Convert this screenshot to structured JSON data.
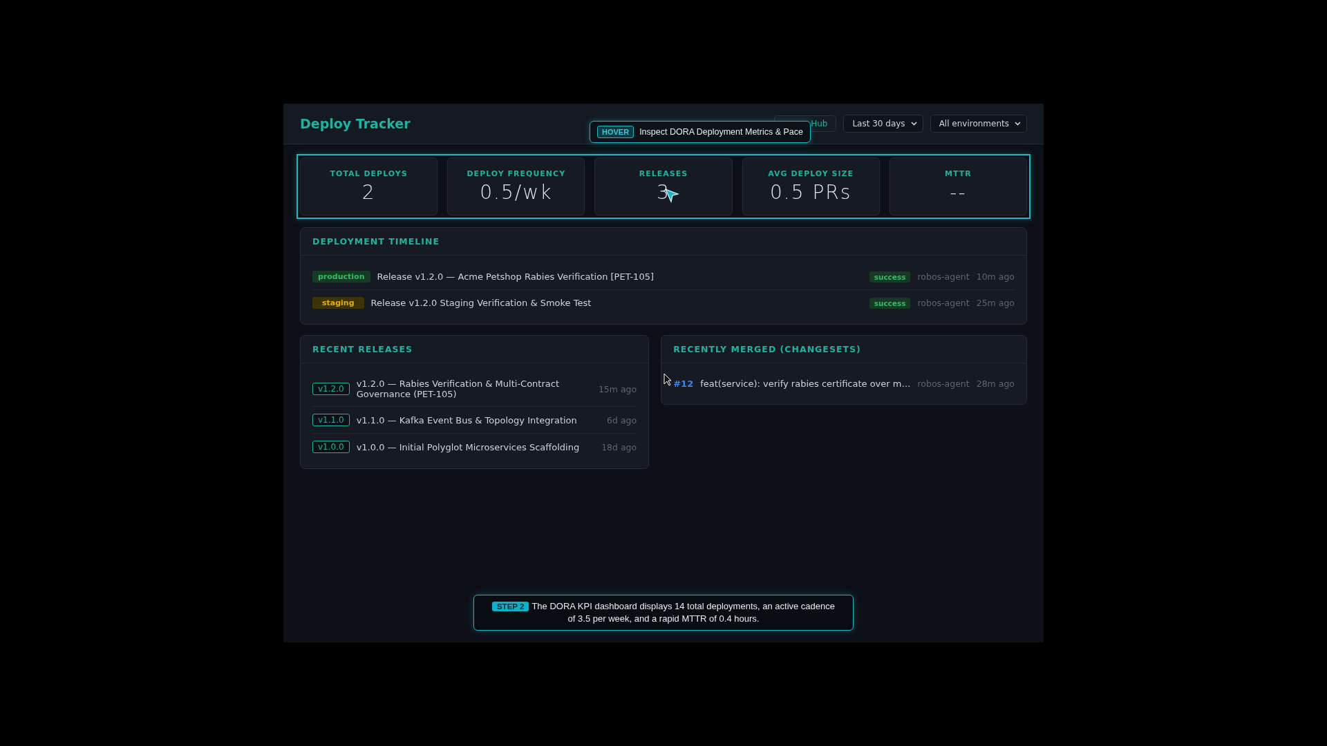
{
  "header": {
    "title": "Deploy Tracker",
    "github_button": "Hub",
    "filters": [
      {
        "label": "Last 30 days"
      },
      {
        "label": "All environments"
      }
    ]
  },
  "tooltip": {
    "badge": "HOVER",
    "text": "Inspect DORA Deployment Metrics & Pace"
  },
  "kpis": [
    {
      "label": "TOTAL DEPLOYS",
      "value": "2"
    },
    {
      "label": "DEPLOY FREQUENCY",
      "value": "0.5/wk"
    },
    {
      "label": "RELEASES",
      "value": "3"
    },
    {
      "label": "AVG DEPLOY SIZE",
      "value": "0.5 PRs"
    },
    {
      "label": "MTTR",
      "value": "--"
    }
  ],
  "timeline": {
    "title": "DEPLOYMENT TIMELINE",
    "rows": [
      {
        "environment": "production",
        "kind": "production",
        "text": "Release v1.2.0 — Acme Petshop Rabies Verification [PET-105]",
        "status": "success",
        "author": "robos-agent",
        "time": "10m ago"
      },
      {
        "environment": "staging",
        "kind": "staging",
        "text": "Release v1.2.0 Staging Verification & Smoke Test",
        "status": "success",
        "author": "robos-agent",
        "time": "25m ago"
      }
    ]
  },
  "releases": {
    "title": "RECENT RELEASES",
    "rows": [
      {
        "version": "v1.2.0",
        "text": "v1.2.0 — Rabies Verification & Multi-Contract Governance (PET-105)",
        "time": "15m ago"
      },
      {
        "version": "v1.1.0",
        "text": "v1.1.0 — Kafka Event Bus & Topology Integration",
        "time": "6d ago"
      },
      {
        "version": "v1.0.0",
        "text": "v1.0.0 — Initial Polyglot Microservices Scaffolding",
        "time": "18d ago"
      }
    ]
  },
  "merged": {
    "title": "RECENTLY MERGED (CHANGESETS)",
    "rows": [
      {
        "number": "#12",
        "text": "feat(service): verify rabies certificate over m…",
        "author": "robos-agent",
        "time": "28m ago"
      }
    ]
  },
  "step": {
    "badge": "STEP 2",
    "text": "The DORA KPI dashboard displays 14 total deployments, an active cadence of 3.5 per week, and a rapid MTTR of 0.4 hours."
  }
}
